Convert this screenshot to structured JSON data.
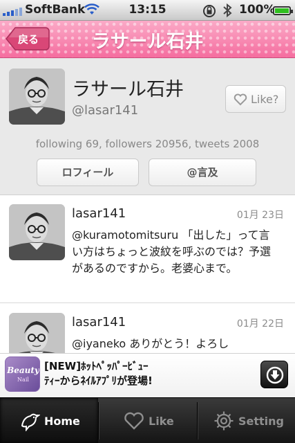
{
  "status_bar": {
    "carrier": "SoftBank",
    "time": "13:15",
    "battery": "100%"
  },
  "nav": {
    "back_label": "戻る",
    "title": "ラサール石井"
  },
  "profile": {
    "name": "ラサール石井",
    "handle": "@lasar141",
    "like_label": "Like?",
    "stats": "following 69, followers 20956, tweets 2008",
    "profile_button": "ロフィール",
    "mentions_button": "@言及"
  },
  "tweets": [
    {
      "user": "lasar141",
      "date": "01月 23日",
      "text": "@kuramotomitsuru 「出した」って言い方はちょっと波紋を呼ぶのでは？予選があるのですから。老婆心まで。"
    },
    {
      "user": "lasar141",
      "date": "01月 22日",
      "text": "@iyaneko ありがとう！よろし"
    }
  ],
  "ad": {
    "icon_text_1": "Beauty",
    "icon_text_2": "Nail",
    "line1": "[NEW]ﾎｯﾄﾍﾟｯﾊﾟｰﾋﾞｭｰ",
    "line2": "ﾃｨｰからﾈｲﾙｱﾌﾟﾘが登場!"
  },
  "tabs": [
    {
      "label": "Home",
      "icon": "bird-icon",
      "active": true
    },
    {
      "label": "Like",
      "icon": "heart-icon",
      "active": false
    },
    {
      "label": "Setting",
      "icon": "gear-icon",
      "active": false
    }
  ],
  "colors": {
    "nav_pink": "#f77aa8",
    "battery_green": "#2fbf1f"
  }
}
